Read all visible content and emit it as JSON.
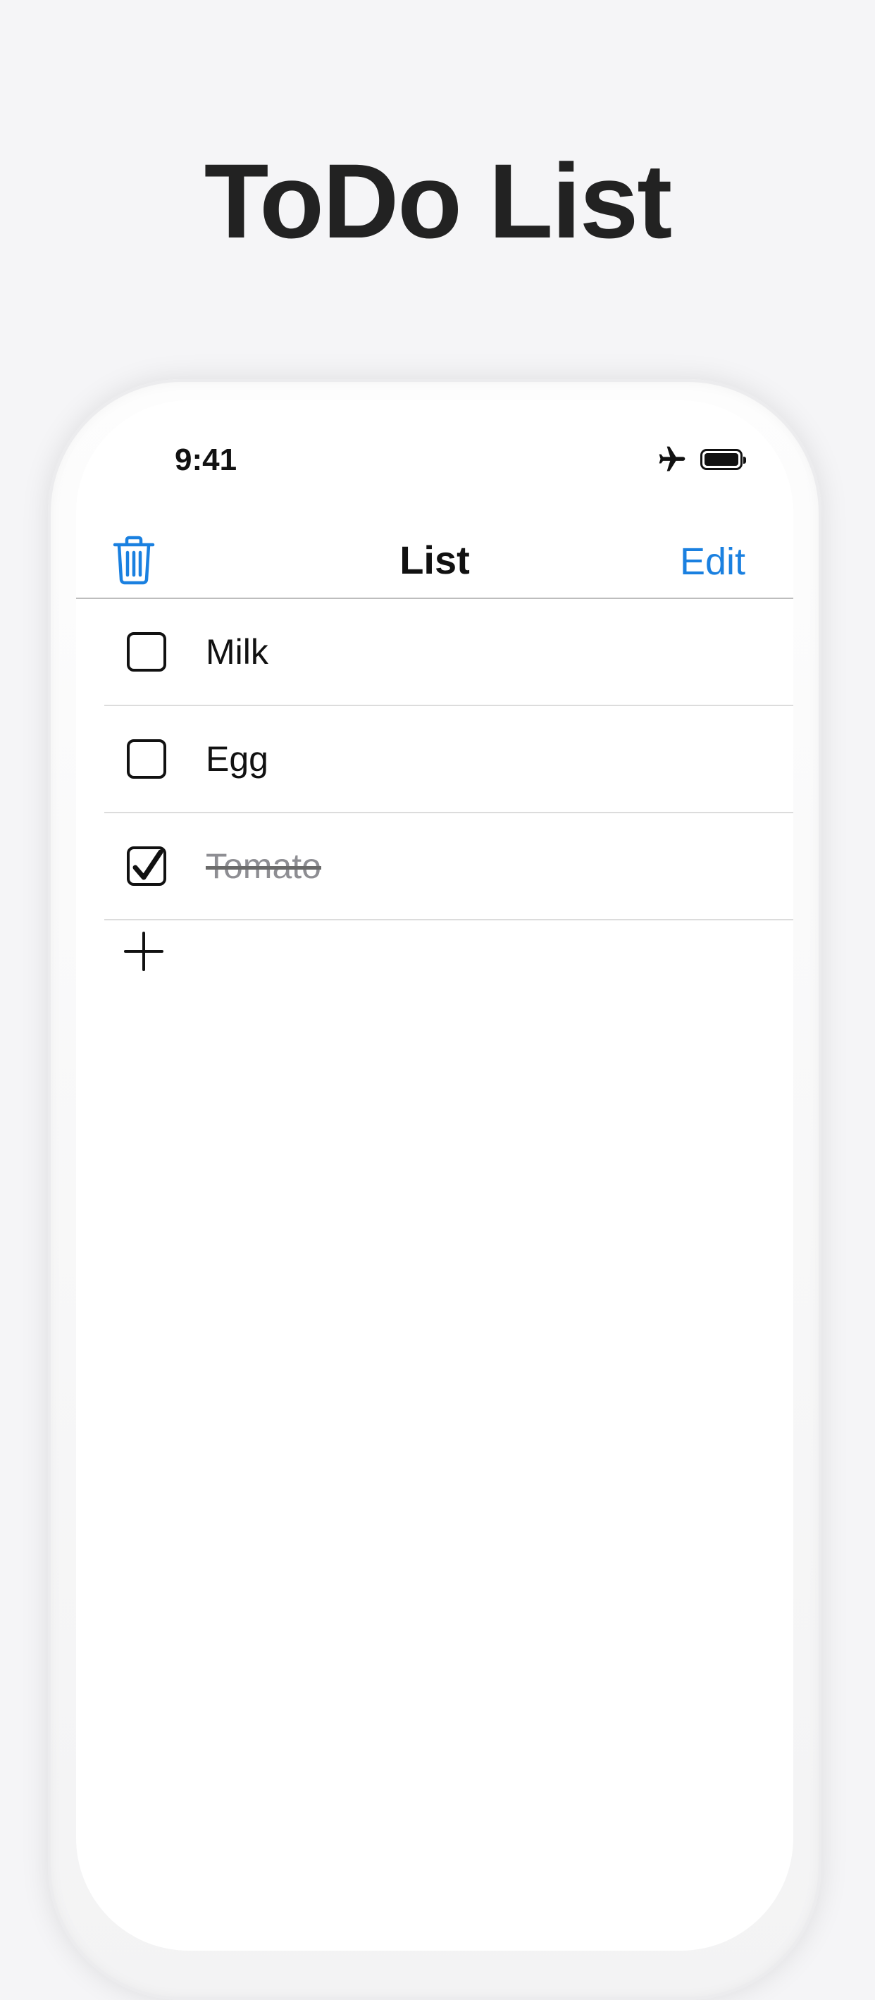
{
  "promo": {
    "title": "ToDo List"
  },
  "status_bar": {
    "time": "9:41",
    "icons": [
      "airplane-icon",
      "battery-icon"
    ]
  },
  "nav": {
    "title": "List",
    "edit_label": "Edit",
    "left_icon": "trash-icon"
  },
  "items": [
    {
      "label": "Milk",
      "checked": false
    },
    {
      "label": "Egg",
      "checked": false
    },
    {
      "label": "Tomato",
      "checked": true
    }
  ],
  "add_icon": "plus-icon",
  "colors": {
    "accent": "#1a80e0",
    "background": "#f5f5f7",
    "title": "#222222",
    "done_text": "#8e8e93"
  }
}
